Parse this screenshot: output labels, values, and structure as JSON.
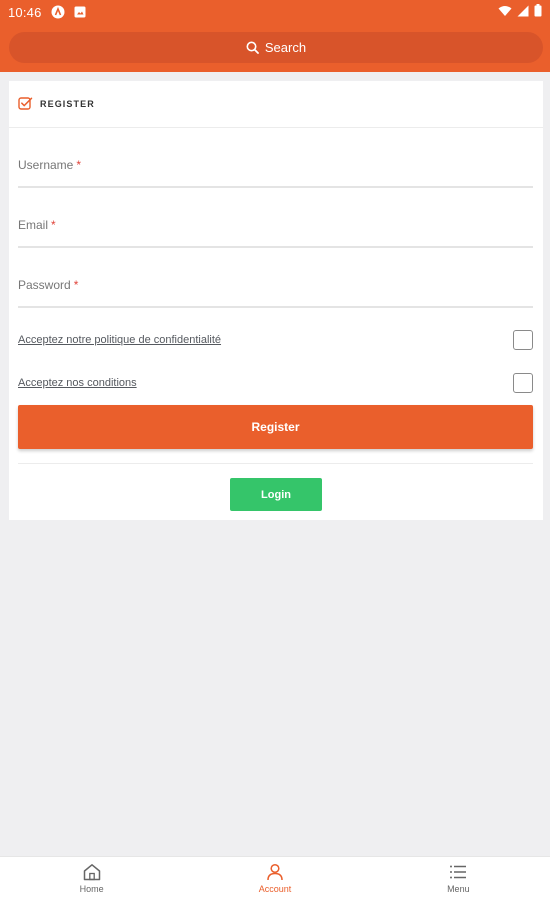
{
  "status_bar": {
    "time": "10:46",
    "left_icons": [
      "android-notification-icon",
      "image-notification-icon"
    ],
    "right_icons": [
      "wifi-icon",
      "signal-icon",
      "battery-icon"
    ]
  },
  "search": {
    "label": "Search",
    "icon": "search-icon"
  },
  "register_card": {
    "title": "REGISTER",
    "icon": "checkbox-edit-icon",
    "fields": [
      {
        "label": "Username",
        "required_mark": "*",
        "value": ""
      },
      {
        "label": "Email",
        "required_mark": "*",
        "value": ""
      },
      {
        "label": "Password",
        "required_mark": "*",
        "value": ""
      }
    ],
    "consents": [
      {
        "label": "Acceptez notre politique de confidentialité",
        "checked": false
      },
      {
        "label": "Acceptez nos conditions",
        "checked": false
      }
    ],
    "register_label": "Register",
    "login_label": "Login"
  },
  "bottom_nav": {
    "items": [
      {
        "label": "Home",
        "icon": "home-icon",
        "active": false
      },
      {
        "label": "Account",
        "icon": "account-icon",
        "active": true
      },
      {
        "label": "Menu",
        "icon": "menu-icon",
        "active": false
      }
    ]
  },
  "colors": {
    "brand": "#ea5f2c",
    "search_bg": "#d8542a",
    "login_green": "#35c56a",
    "required_red": "#e0433a",
    "page_bg": "#efeff1"
  }
}
